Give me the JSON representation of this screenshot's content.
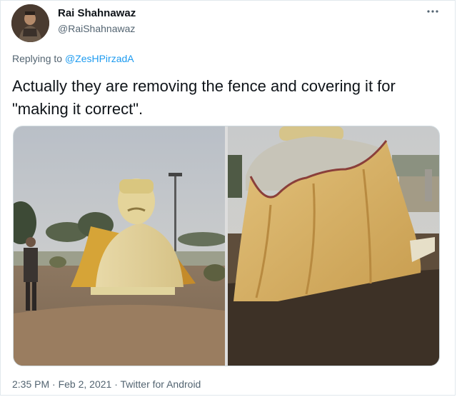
{
  "tweet": {
    "author_name": "Rai Shahnawaz",
    "author_handle": "@RaiShahnawaz",
    "more_icon": "more-dots-icon",
    "replying_prefix": "Replying to",
    "replying_mention": "@ZesHPirzadA",
    "text": "Actually they are removing the fence and covering it for \"making it correct\".",
    "timestamp": "2:35 PM · Feb 2, 2021",
    "source_separator": " · ",
    "source": "Twitter for Android"
  },
  "colors": {
    "text_primary": "#0f1419",
    "text_secondary": "#536471",
    "link": "#1d9bf0",
    "border": "#cfd9de"
  }
}
